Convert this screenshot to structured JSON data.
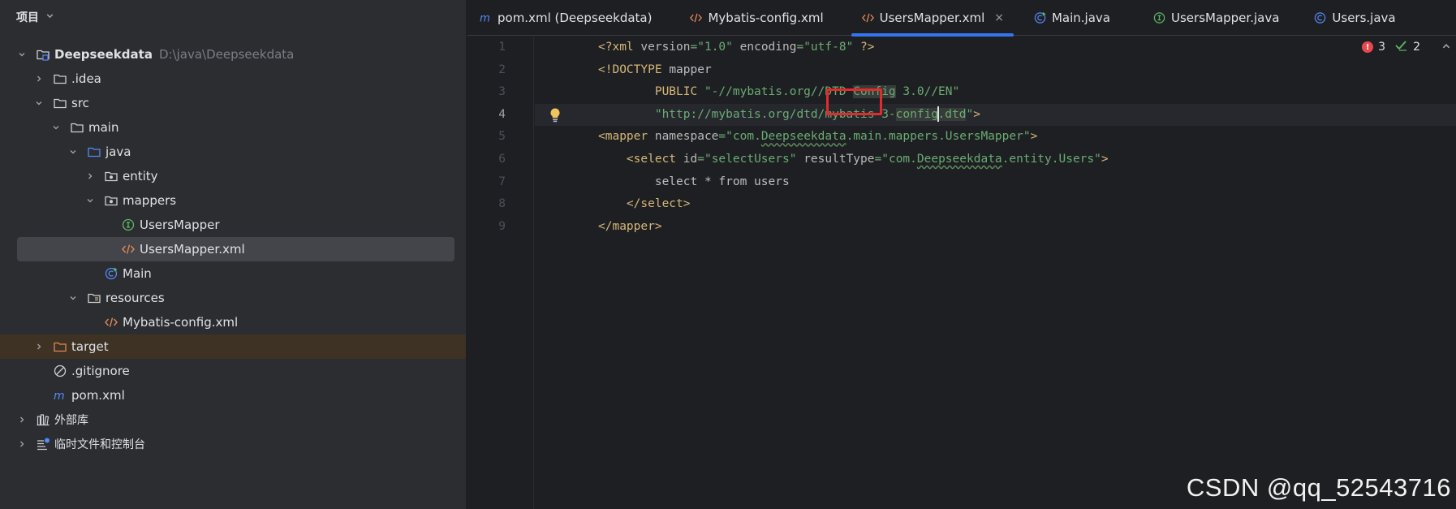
{
  "project_panel": {
    "title": "项目",
    "tree": [
      {
        "label": "Deepseekdata",
        "hint": "D:\\java\\Deepseekdata",
        "depth": 0,
        "expanded": true,
        "icon": "module-folder-icon",
        "bold": true
      },
      {
        "label": ".idea",
        "depth": 1,
        "expanded": false,
        "icon": "folder-icon"
      },
      {
        "label": "src",
        "depth": 1,
        "expanded": true,
        "icon": "folder-icon"
      },
      {
        "label": "main",
        "depth": 2,
        "expanded": true,
        "icon": "folder-icon"
      },
      {
        "label": "java",
        "depth": 3,
        "expanded": true,
        "icon": "source-folder-icon"
      },
      {
        "label": "entity",
        "depth": 4,
        "expanded": false,
        "icon": "package-icon"
      },
      {
        "label": "mappers",
        "depth": 4,
        "expanded": true,
        "icon": "package-icon"
      },
      {
        "label": "UsersMapper",
        "depth": 5,
        "leaf": true,
        "icon": "interface-icon"
      },
      {
        "label": "UsersMapper.xml",
        "depth": 5,
        "leaf": true,
        "icon": "xml-file-icon",
        "selected": true
      },
      {
        "label": "Main",
        "depth": 4,
        "leaf": true,
        "icon": "class-run-icon"
      },
      {
        "label": "resources",
        "depth": 3,
        "expanded": true,
        "icon": "resources-folder-icon"
      },
      {
        "label": "Mybatis-config.xml",
        "depth": 4,
        "leaf": true,
        "icon": "xml-file-icon"
      },
      {
        "label": "target",
        "depth": 1,
        "expanded": false,
        "icon": "excluded-folder-icon",
        "excluded": true
      },
      {
        "label": ".gitignore",
        "depth": 1,
        "leaf": true,
        "icon": "ignore-file-icon"
      },
      {
        "label": "pom.xml",
        "depth": 1,
        "leaf": true,
        "icon": "maven-icon"
      },
      {
        "label": "外部库",
        "depth": 0,
        "expanded": false,
        "icon": "library-icon"
      },
      {
        "label": "临时文件和控制台",
        "depth": 0,
        "expanded": false,
        "icon": "scratches-icon"
      }
    ]
  },
  "tabs": [
    {
      "label": "pom.xml (Deepseekdata)",
      "icon": "maven-icon"
    },
    {
      "label": "Mybatis-config.xml",
      "icon": "xml-file-icon"
    },
    {
      "label": "UsersMapper.xml",
      "icon": "xml-file-icon",
      "active": true,
      "close": "×"
    },
    {
      "label": "Main.java",
      "icon": "class-run-icon"
    },
    {
      "label": "UsersMapper.java",
      "icon": "interface-icon"
    },
    {
      "label": "Users.java",
      "icon": "class-icon"
    }
  ],
  "editor": {
    "line_numbers": [
      "1",
      "2",
      "3",
      "4",
      "5",
      "6",
      "7",
      "8",
      "9"
    ],
    "current_line": 4,
    "inspections": {
      "errors": "3",
      "warnings": "2"
    }
  },
  "watermark": "CSDN @qq_52543716",
  "colors": {
    "accent": "#3574f0",
    "error": "#e5484d",
    "highlight_box": "#e22c2c"
  }
}
